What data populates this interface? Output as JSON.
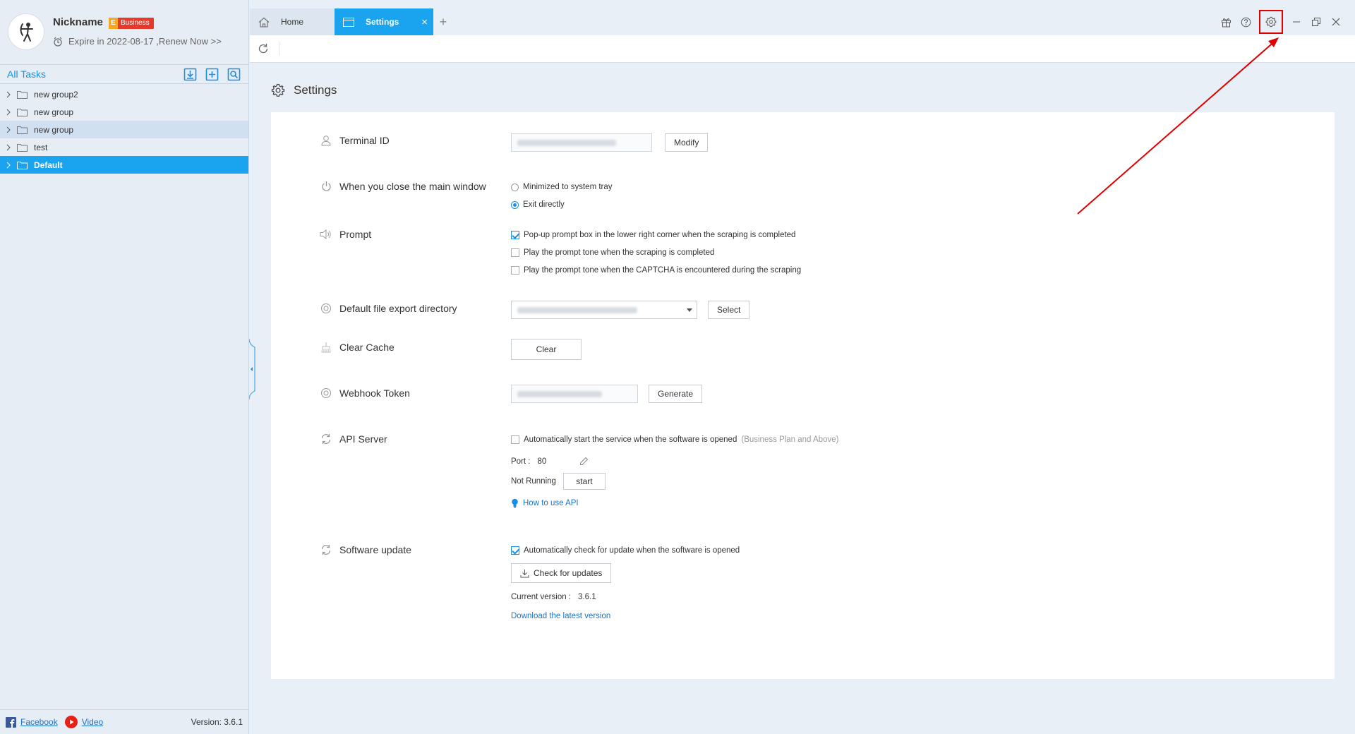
{
  "profile": {
    "nickname": "Nickname",
    "plan_badge_letter": "E",
    "plan_badge": "Business",
    "expire_text": "Expire in 2022-08-17 ,Renew Now >>"
  },
  "tasks": {
    "title": "All Tasks",
    "items": [
      {
        "label": "new group2"
      },
      {
        "label": "new group"
      },
      {
        "label": "new group"
      },
      {
        "label": "test"
      },
      {
        "label": "Default"
      }
    ]
  },
  "footer": {
    "facebook": "Facebook",
    "video": "Video",
    "version": "Version: 3.6.1"
  },
  "tabs": [
    {
      "label": "Home",
      "icon": "home-icon"
    },
    {
      "label": "Settings",
      "icon": "window-icon",
      "close": "×"
    }
  ],
  "tab_add": "+",
  "settings": {
    "title": "Settings",
    "terminal_id": {
      "label": "Terminal ID",
      "modify": "Modify"
    },
    "close_window": {
      "label": "When you close the main window",
      "options": [
        "Minimized to system tray",
        "Exit directly"
      ],
      "selected": 1
    },
    "prompt": {
      "label": "Prompt",
      "options": [
        {
          "text": "Pop-up prompt box in the lower right corner when the scraping is completed",
          "checked": true
        },
        {
          "text": "Play the prompt tone when the scraping is completed",
          "checked": false
        },
        {
          "text": "Play the prompt tone when the CAPTCHA is encountered during the scraping",
          "checked": false
        }
      ]
    },
    "export_dir": {
      "label": "Default file export directory",
      "select": "Select"
    },
    "clear_cache": {
      "label": "Clear Cache",
      "button": "Clear"
    },
    "webhook": {
      "label": "Webhook Token",
      "button": "Generate"
    },
    "api_server": {
      "label": "API Server",
      "auto_start": "Automatically start the service when the software is opened",
      "auto_start_note": "(Business Plan and Above)",
      "auto_start_checked": false,
      "port_label": "Port :",
      "port_value": "80",
      "status": "Not Running",
      "start": "start",
      "how_to": "How to use API"
    },
    "software_update": {
      "label": "Software update",
      "auto_check": "Automatically check for update when the software is opened",
      "auto_check_checked": true,
      "check_button": "Check for updates",
      "current_version_label": "Current version :",
      "current_version": "3.6.1",
      "download_link": "Download the latest version"
    }
  },
  "colors": {
    "accent": "#1aa3ef",
    "link": "#1a73c8",
    "badge": "#e53a2b",
    "annotation": "#e00000"
  }
}
